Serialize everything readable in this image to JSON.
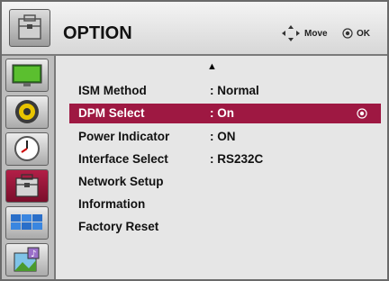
{
  "header": {
    "title": "OPTION",
    "move_label": "Move",
    "ok_label": "OK",
    "icon": "toolbox-icon"
  },
  "sidebar": {
    "items": [
      {
        "name": "picture",
        "icon": "monitor-icon"
      },
      {
        "name": "sound",
        "icon": "speaker-icon"
      },
      {
        "name": "time",
        "icon": "clock-icon"
      },
      {
        "name": "option",
        "icon": "toolbox-icon",
        "active": true
      },
      {
        "name": "picture-id",
        "icon": "multi-screen-icon"
      },
      {
        "name": "photo",
        "icon": "photo-icon"
      }
    ]
  },
  "menu": {
    "scroll_up": "▲",
    "items": [
      {
        "label": "ISM Method",
        "value": ": Normal"
      },
      {
        "label": "DPM Select",
        "value": ": On",
        "selected": true
      },
      {
        "label": "Power Indicator",
        "value": ": ON"
      },
      {
        "label": "Interface Select",
        "value": ": RS232C"
      },
      {
        "label": "Network Setup",
        "value": ""
      },
      {
        "label": "Information",
        "value": ""
      },
      {
        "label": "Factory Reset",
        "value": ""
      }
    ]
  },
  "colors": {
    "accent": "#9e1842",
    "background": "#e6e6e6",
    "header": "#d9d9d9"
  }
}
